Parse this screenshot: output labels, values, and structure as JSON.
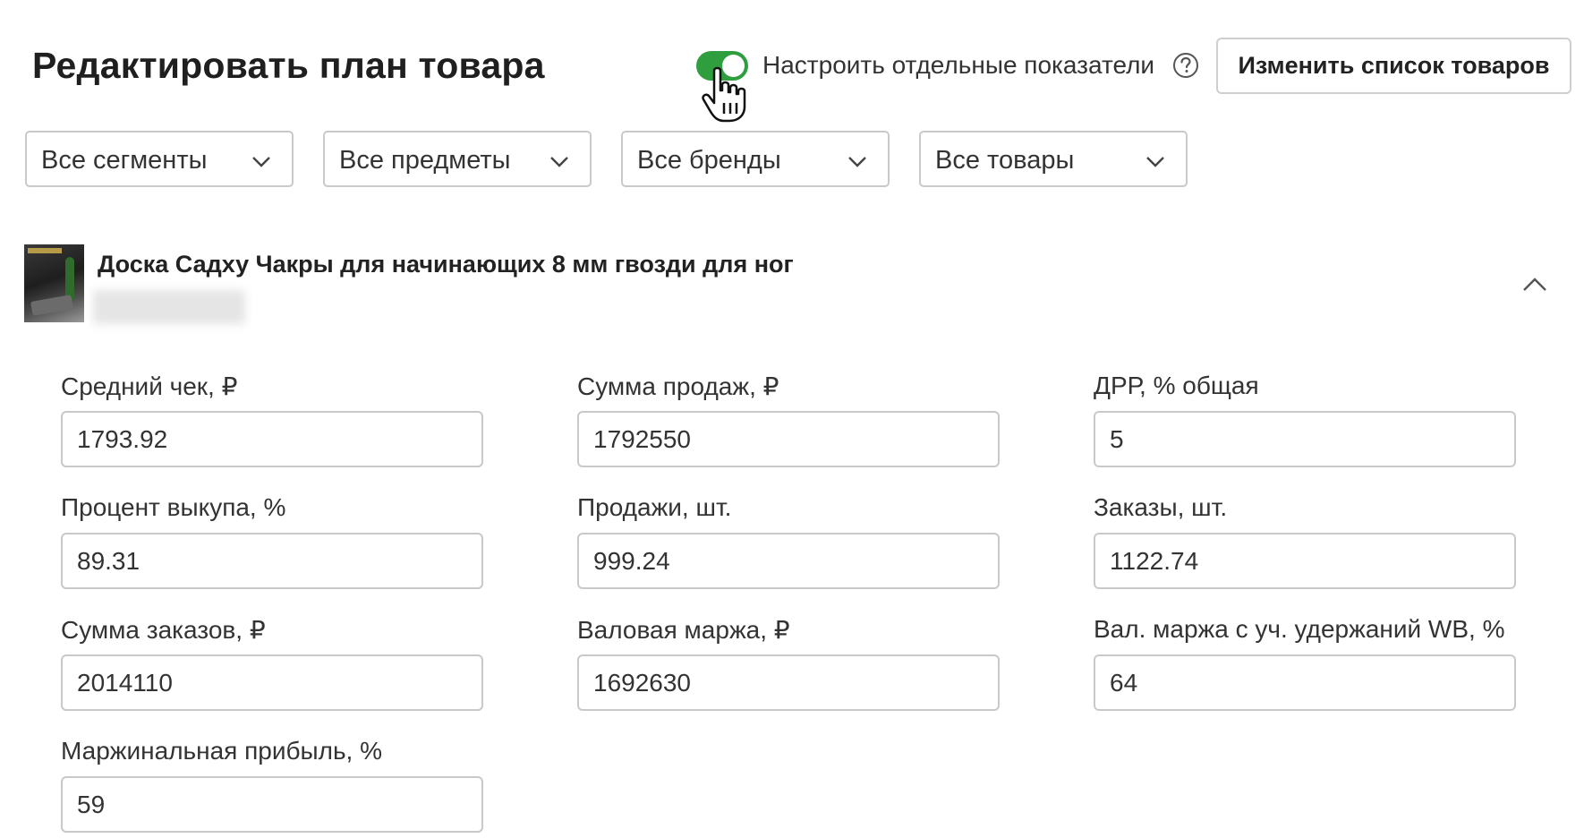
{
  "header": {
    "title": "Редактировать план товара",
    "toggle_label": "Настроить отдельные показатели",
    "toggle_on": true,
    "change_list_button": "Изменить список товаров"
  },
  "filters": [
    {
      "label": "Все сегменты"
    },
    {
      "label": "Все предметы"
    },
    {
      "label": "Все бренды"
    },
    {
      "label": "Все товары"
    }
  ],
  "product": {
    "name": "Доска Садху Чакры для начинающих 8 мм гвозди для ног"
  },
  "fields": {
    "avg_check": {
      "label": "Средний чек, ₽",
      "value": "1793.92"
    },
    "sales_sum": {
      "label": "Сумма продаж, ₽",
      "value": "1792550"
    },
    "drr_total": {
      "label": "ДРР, % общая",
      "value": "5"
    },
    "buyout_percent": {
      "label": "Процент выкупа, %",
      "value": "89.31"
    },
    "sales_qty": {
      "label": "Продажи, шт.",
      "value": "999.24"
    },
    "orders_qty": {
      "label": "Заказы, шт.",
      "value": "1122.74"
    },
    "orders_sum": {
      "label": "Сумма заказов, ₽",
      "value": "2014110"
    },
    "gross_margin": {
      "label": "Валовая маржа, ₽",
      "value": "1692630"
    },
    "gross_margin_wb": {
      "label": "Вал. маржа с уч. удержаний WB, %",
      "value": "64"
    },
    "marginal_profit": {
      "label": "Маржинальная прибыль, %",
      "value": "59"
    }
  },
  "colors": {
    "toggle_on": "#2e9e3f",
    "border": "#c9c9c9"
  }
}
